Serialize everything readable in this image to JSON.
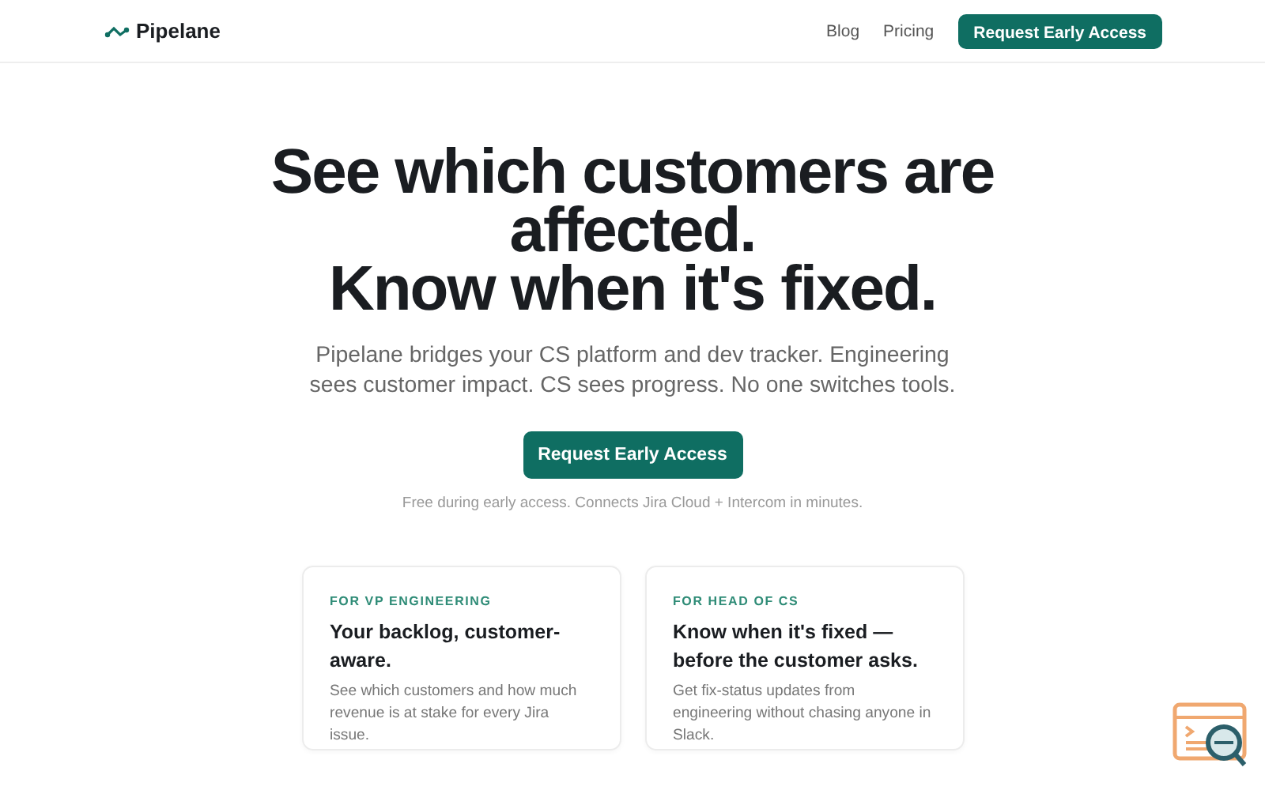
{
  "nav": {
    "brand": "Pipelane",
    "links": [
      "Blog",
      "Pricing"
    ],
    "cta": "Request Early Access"
  },
  "hero": {
    "headline": [
      "See which customers are",
      "affected.",
      "Know when it's fixed."
    ],
    "subtitle": "Pipelane bridges your CS platform and dev tracker. Engineering sees customer impact. CS sees progress. No one switches tools.",
    "cta": "Request Early Access",
    "note": "Free during early access. Connects Jira Cloud + Intercom in minutes."
  },
  "cards": [
    {
      "eyebrow": "FOR VP ENGINEERING",
      "title": "Your backlog, customer-aware.",
      "body": "See which customers and how much revenue is at stake for every Jira issue."
    },
    {
      "eyebrow": "FOR HEAD OF CS",
      "title": "Know when it's fixed — before the customer asks.",
      "body": "Get fix-status updates from engineering without chasing anyone in Slack."
    }
  ]
}
